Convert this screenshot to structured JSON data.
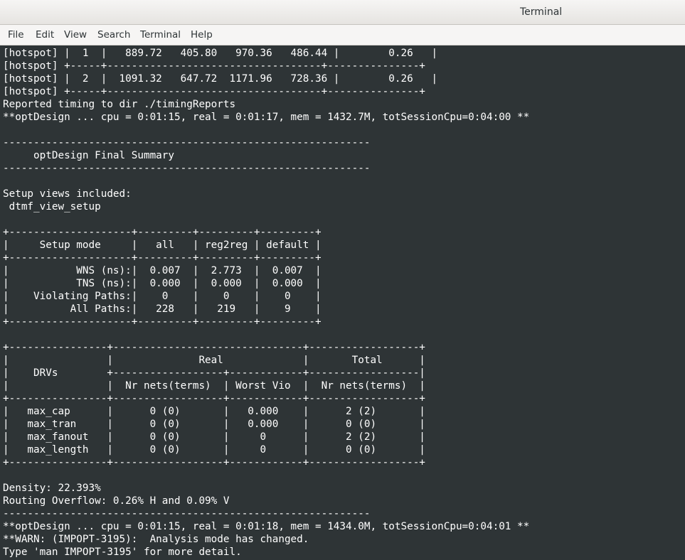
{
  "window": {
    "title": "Terminal"
  },
  "menu": {
    "items": [
      "File",
      "Edit",
      "View",
      "Search",
      "Terminal",
      "Help"
    ]
  },
  "terminal": {
    "lines": [
      "[hotspot] |  1  |   889.72   405.80   970.36   486.44 |        0.26   |",
      "[hotspot] +-----+-----------------------------------+---------------+",
      "[hotspot] |  2  |  1091.32   647.72  1171.96   728.36 |        0.26   |",
      "[hotspot] +-----+-----------------------------------+---------------+",
      "Reported timing to dir ./timingReports",
      "**optDesign ... cpu = 0:01:15, real = 0:01:17, mem = 1432.7M, totSessionCpu=0:04:00 **",
      "",
      "------------------------------------------------------------",
      "     optDesign Final Summary",
      "------------------------------------------------------------",
      "",
      "Setup views included:",
      " dtmf_view_setup",
      "",
      "+--------------------+---------+---------+---------+",
      "|     Setup mode     |   all   | reg2reg | default |",
      "+--------------------+---------+---------+---------+",
      "|           WNS (ns):|  0.007  |  2.773  |  0.007  |",
      "|           TNS (ns):|  0.000  |  0.000  |  0.000  |",
      "|    Violating Paths:|    0    |    0    |    0    |",
      "|          All Paths:|   228   |   219   |    9    |",
      "+--------------------+---------+---------+---------+",
      "",
      "+----------------+-------------------------------+------------------+",
      "|                |              Real             |       Total      |",
      "|    DRVs        +------------------+------------+------------------|",
      "|                |  Nr nets(terms)  | Worst Vio  |  Nr nets(terms)  |",
      "+----------------+------------------+------------+------------------+",
      "|   max_cap      |      0 (0)       |   0.000    |      2 (2)       |",
      "|   max_tran     |      0 (0)       |   0.000    |      0 (0)       |",
      "|   max_fanout   |      0 (0)       |     0      |      2 (2)       |",
      "|   max_length   |      0 (0)       |     0      |      0 (0)       |",
      "+----------------+------------------+------------+------------------+",
      "",
      "Density: 22.393%",
      "Routing Overflow: 0.26% H and 0.09% V",
      "------------------------------------------------------------",
      "**optDesign ... cpu = 0:01:15, real = 0:01:18, mem = 1434.0M, totSessionCpu=0:04:01 **",
      "**WARN: (IMPOPT-3195):  Analysis mode has changed.",
      "Type 'man IMPOPT-3195' for more detail."
    ]
  }
}
